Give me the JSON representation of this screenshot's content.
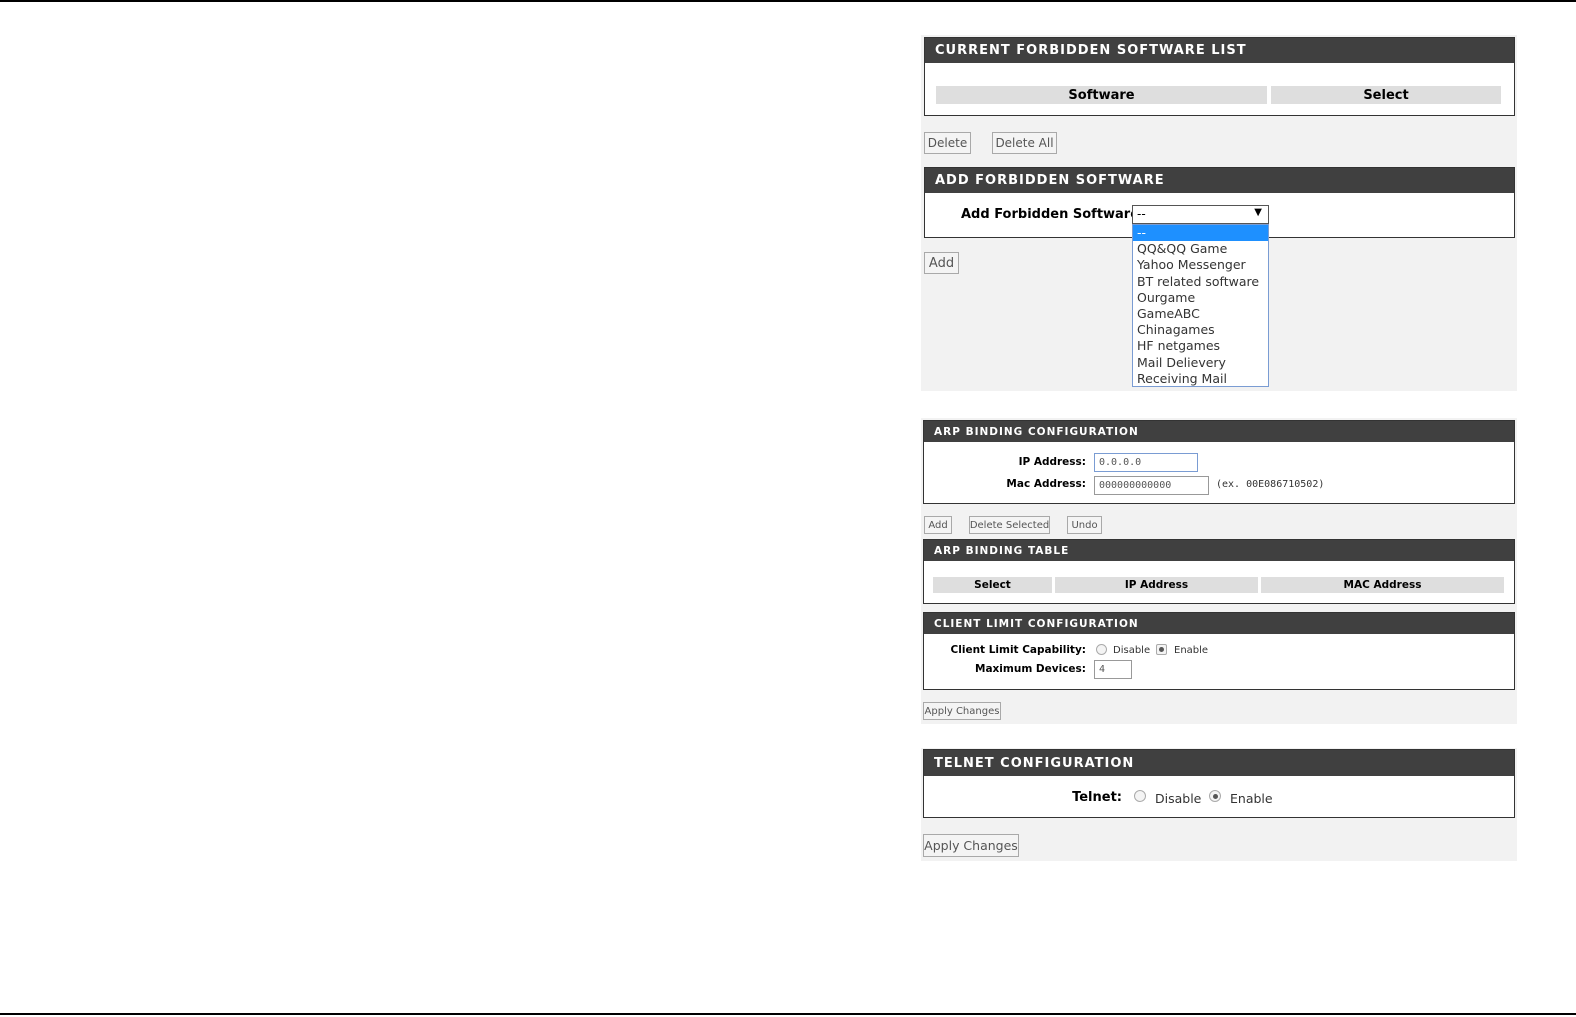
{
  "forbidden_list": {
    "header": "CURRENT FORBIDDEN SOFTWARE LIST",
    "columns": [
      "Software",
      "Select"
    ],
    "delete_label": "Delete",
    "delete_all_label": "Delete All"
  },
  "add_forbidden": {
    "header": "ADD FORBIDDEN SOFTWARE",
    "field_label": "Add Forbidden Software:",
    "selected_value": "--",
    "options": [
      "--",
      "QQ&QQ Game",
      "Yahoo Messenger",
      "BT related software",
      "Ourgame",
      "GameABC",
      "Chinagames",
      "HF netgames",
      "Mail Delievery",
      "Receiving Mail"
    ],
    "add_label": "Add"
  },
  "arp_config": {
    "header": "ARP BINDING CONFIGURATION",
    "ip_label": "IP Address:",
    "ip_value": "0.0.0.0",
    "mac_label": "Mac Address:",
    "mac_value": "000000000000",
    "mac_hint": "(ex. 00E086710502)",
    "add_label": "Add",
    "delete_selected_label": "Delete Selected",
    "undo_label": "Undo"
  },
  "arp_table": {
    "header": "ARP BINDING TABLE",
    "columns": [
      "Select",
      "IP Address",
      "MAC Address"
    ]
  },
  "client_limit": {
    "header": "CLIENT LIMIT CONFIGURATION",
    "capability_label": "Client Limit Capability:",
    "disable_label": "Disable",
    "enable_label": "Enable",
    "selected": "Enable",
    "max_label": "Maximum Devices:",
    "max_value": "4",
    "apply_label": "Apply Changes"
  },
  "telnet": {
    "header": "TELNET CONFIGURATION",
    "label": "Telnet:",
    "disable_label": "Disable",
    "enable_label": "Enable",
    "selected": "Enable",
    "apply_label": "Apply Changes"
  }
}
